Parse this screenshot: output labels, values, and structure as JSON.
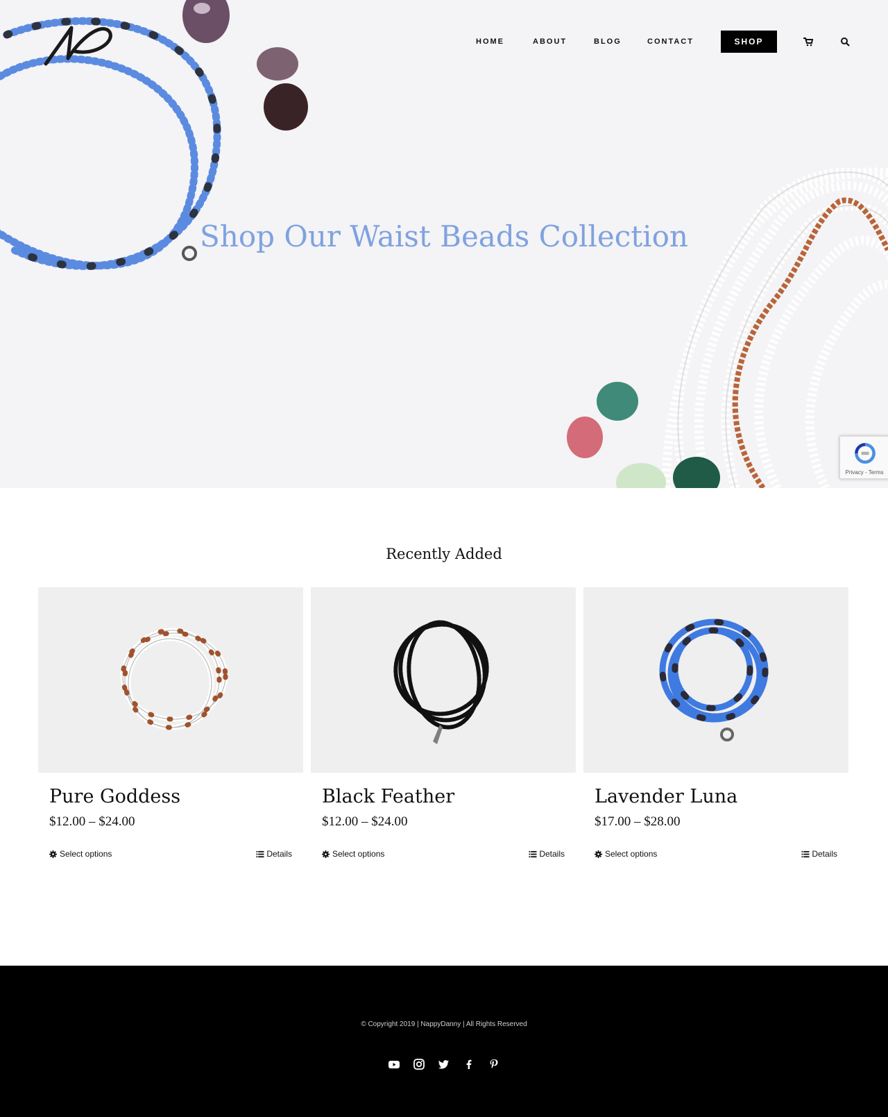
{
  "brand": {
    "logo_alt": "NappyDanny logo"
  },
  "nav": {
    "items": [
      "HOME",
      "ABOUT",
      "BLOG",
      "CONTACT"
    ],
    "shop_label": "SHOP",
    "cart_icon": "cart-icon",
    "search_icon": "search-icon"
  },
  "hero": {
    "title": "Shop Our Waist Beads Collection",
    "title_color": "#7fa2df"
  },
  "recaptcha": {
    "text": "Privacy - Terms"
  },
  "recent": {
    "title": "Recently Added",
    "products": [
      {
        "name": "Pure Goddess",
        "price": "$12.00 – $24.00",
        "select_label": "Select options",
        "details_label": "Details",
        "bead_color": "#ffffff",
        "accent_color": "#a0522d"
      },
      {
        "name": "Black Feather",
        "price": "$12.00 – $24.00",
        "select_label": "Select options",
        "details_label": "Details",
        "bead_color": "#111111",
        "accent_color": "#8a8a8a"
      },
      {
        "name": "Lavender Luna",
        "price": "$17.00 – $28.00",
        "select_label": "Select options",
        "details_label": "Details",
        "bead_color": "#3f7ae0",
        "accent_color": "#2a2a3a"
      }
    ]
  },
  "footer": {
    "copyright": "© Copyright 2019   |   NappyDanny   |   All Rights Reserved",
    "socials": [
      "youtube-icon",
      "instagram-icon",
      "twitter-icon",
      "facebook-icon",
      "pinterest-icon"
    ]
  }
}
